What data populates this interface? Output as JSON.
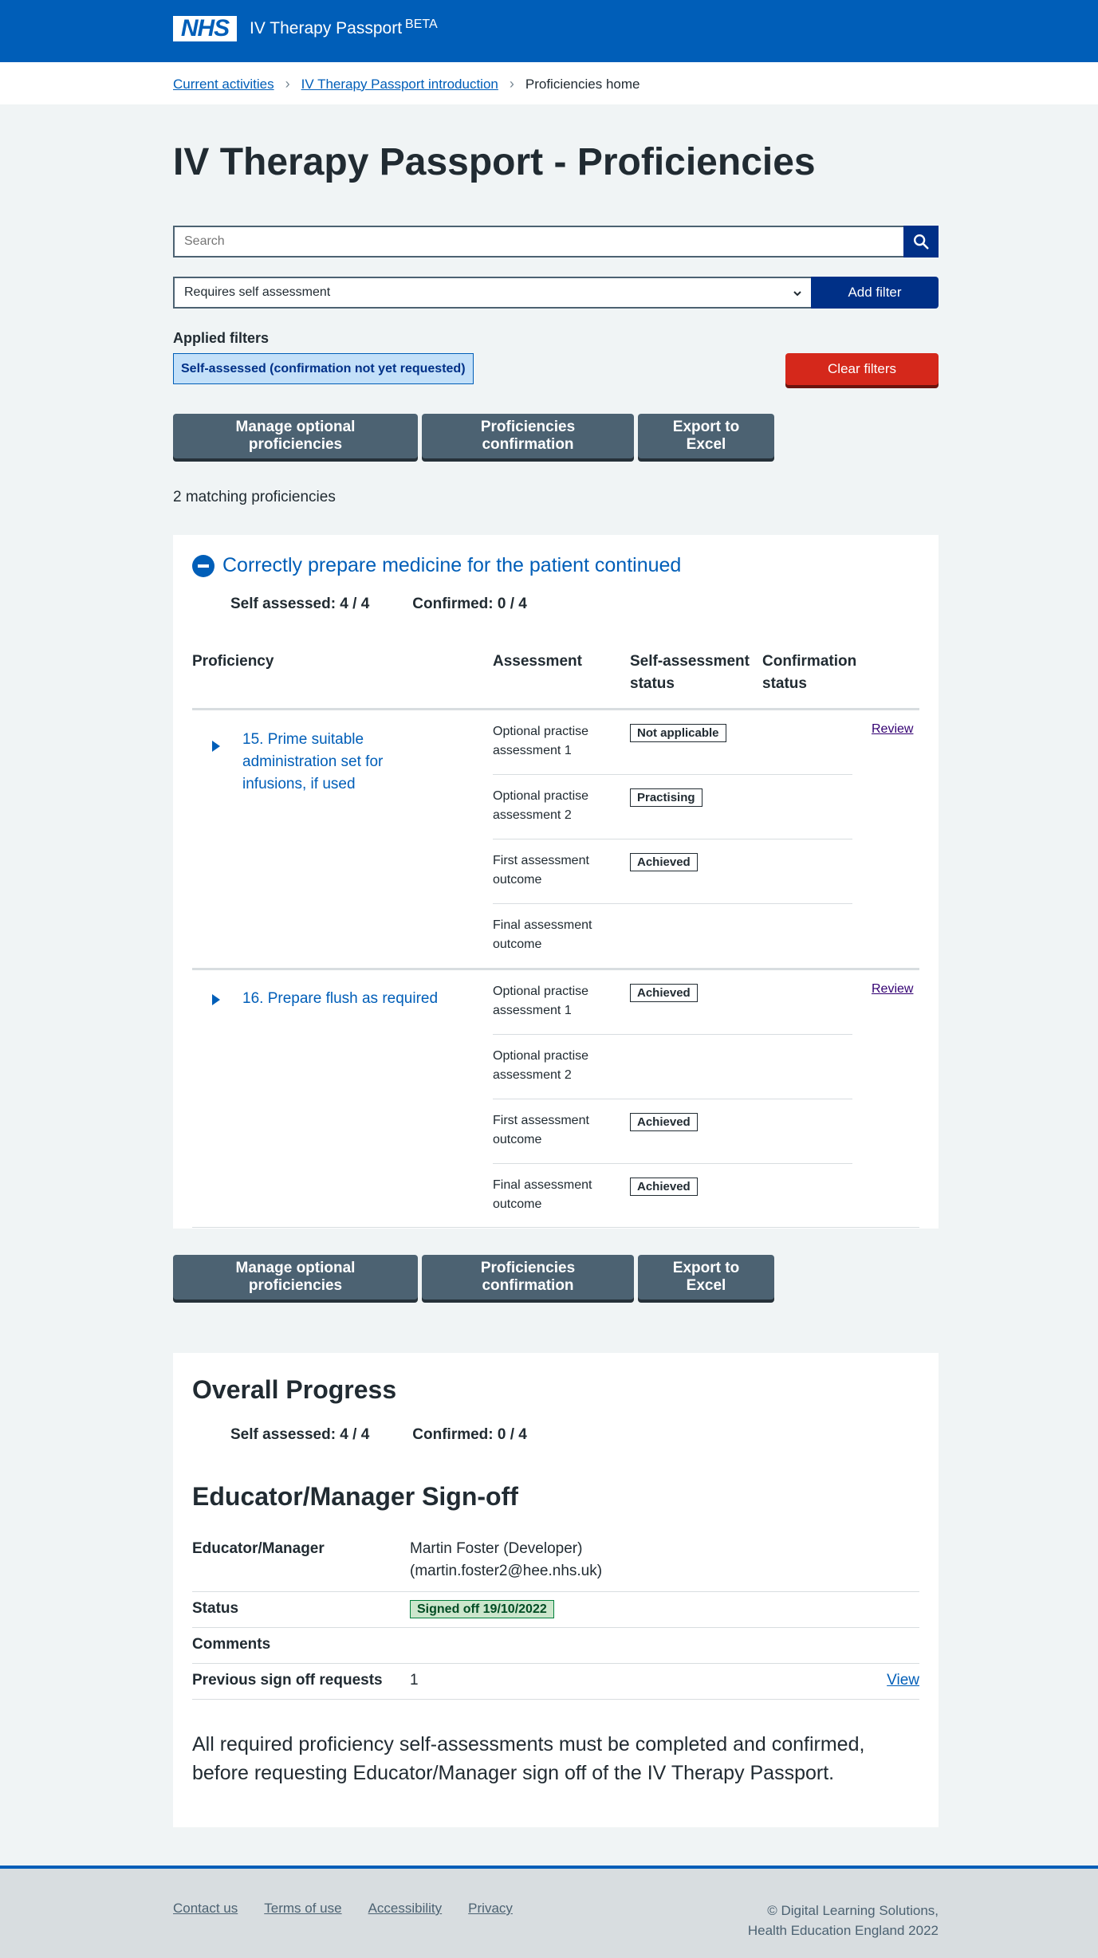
{
  "header": {
    "logo_text": "NHS",
    "service_name": "IV Therapy Passport",
    "beta_label": "BETA"
  },
  "breadcrumb": {
    "items": [
      "Current activities",
      "IV Therapy Passport introduction"
    ],
    "current": "Proficiencies home"
  },
  "page_title": "IV Therapy Passport - Proficiencies",
  "search": {
    "placeholder": "Search"
  },
  "filter": {
    "selected": "Requires self assessment",
    "add_button": "Add filter"
  },
  "applied_filters": {
    "label": "Applied filters",
    "tag": "Self-assessed (confirmation not yet requested)",
    "clear_button": "Clear filters"
  },
  "actions": {
    "manage": "Manage optional proficiencies",
    "confirmation": "Proficiencies confirmation",
    "export": "Export to Excel"
  },
  "matching_text": "2 matching proficiencies",
  "section": {
    "title": "Correctly prepare medicine for the patient continued",
    "self_assessed": "Self assessed: 4 / 4",
    "confirmed": "Confirmed: 0 / 4",
    "columns": {
      "proficiency": "Proficiency",
      "assessment": "Assessment",
      "self_status_1": "Self-assessment",
      "self_status_2": "status",
      "conf_status_1": "Confirmation",
      "conf_status_2": "status"
    },
    "proficiencies": [
      {
        "name": "15. Prime suitable administration set for infusions, if used",
        "review": "Review",
        "assessments": [
          {
            "label": "Optional practise assessment 1",
            "status": "Not applicable"
          },
          {
            "label": "Optional practise assessment 2",
            "status": "Practising"
          },
          {
            "label": "First assessment outcome",
            "status": "Achieved"
          },
          {
            "label": "Final assessment outcome",
            "status": ""
          }
        ]
      },
      {
        "name": "16. Prepare flush as required",
        "review": "Review",
        "assessments": [
          {
            "label": "Optional practise assessment 1",
            "status": "Achieved"
          },
          {
            "label": "Optional practise assessment 2",
            "status": ""
          },
          {
            "label": "First assessment outcome",
            "status": "Achieved"
          },
          {
            "label": "Final assessment outcome",
            "status": "Achieved"
          }
        ]
      }
    ]
  },
  "progress": {
    "title": "Overall Progress",
    "self_assessed": "Self assessed: 4 / 4",
    "confirmed": "Confirmed: 0 / 4",
    "signoff_title": "Educator/Manager Sign-off",
    "rows": {
      "manager_key": "Educator/Manager",
      "manager_name": "Martin Foster (Developer)",
      "manager_email": "(martin.foster2@hee.nhs.uk)",
      "status_key": "Status",
      "status_value": "Signed off 19/10/2022",
      "comments_key": "Comments",
      "previous_key": "Previous sign off requests",
      "previous_value": "1",
      "view_link": "View"
    },
    "notice": "All required proficiency self-assessments must be completed and confirmed, before requesting Educator/Manager sign off of the IV Therapy Passport."
  },
  "footer": {
    "links": [
      "Contact us",
      "Terms of use",
      "Accessibility",
      "Privacy"
    ],
    "copyright_1": "© Digital Learning Solutions,",
    "copyright_2": "Health Education England 2022"
  },
  "colors": {
    "nhs_blue": "#005eb8",
    "dark_blue": "#003087",
    "red": "#d5281b",
    "grey_button": "#4c6272",
    "green_tag": "#cce6cc"
  }
}
